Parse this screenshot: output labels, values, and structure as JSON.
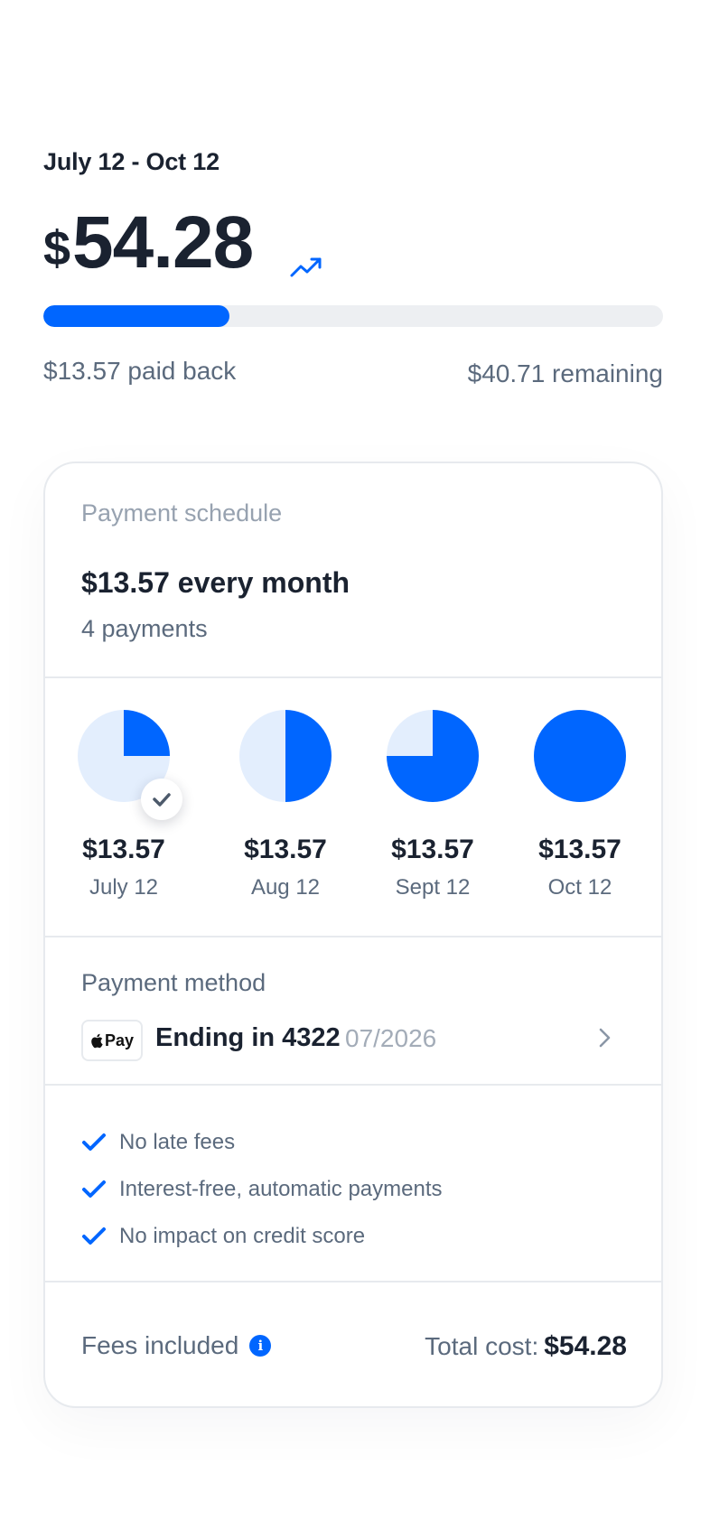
{
  "header": {
    "date_range": "July 12  - Oct 12",
    "currency_symbol": "$",
    "total_amount": "54.28",
    "trend_icon": "trending-up-icon",
    "progress_fraction": 0.3,
    "paid_back": "$13.57 paid back",
    "remaining": "$40.71 remaining"
  },
  "schedule": {
    "title": "Payment schedule",
    "summary": "$13.57 every month",
    "count": "4 payments",
    "payments": [
      {
        "amount": "$13.57",
        "date": "July 12",
        "fraction": 0.25,
        "paid": true
      },
      {
        "amount": "$13.57",
        "date": "Aug 12",
        "fraction": 0.5,
        "paid": false
      },
      {
        "amount": "$13.57",
        "date": "Sept 12",
        "fraction": 0.75,
        "paid": false
      },
      {
        "amount": "$13.57",
        "date": "Oct 12",
        "fraction": 1.0,
        "paid": false
      }
    ]
  },
  "payment_method": {
    "title": "Payment method",
    "badge": "Pay",
    "badge_icon": "apple-icon",
    "ending": "Ending in 4322",
    "expiry": "07/2026"
  },
  "features": [
    "No late fees",
    "Interest-free, automatic payments",
    "No impact on credit score"
  ],
  "footer": {
    "fees_label": "Fees included",
    "total_label": "Total cost:",
    "total_value": "$54.28"
  },
  "colors": {
    "accent": "#0066ff",
    "pie_light": "#e3eefd"
  }
}
